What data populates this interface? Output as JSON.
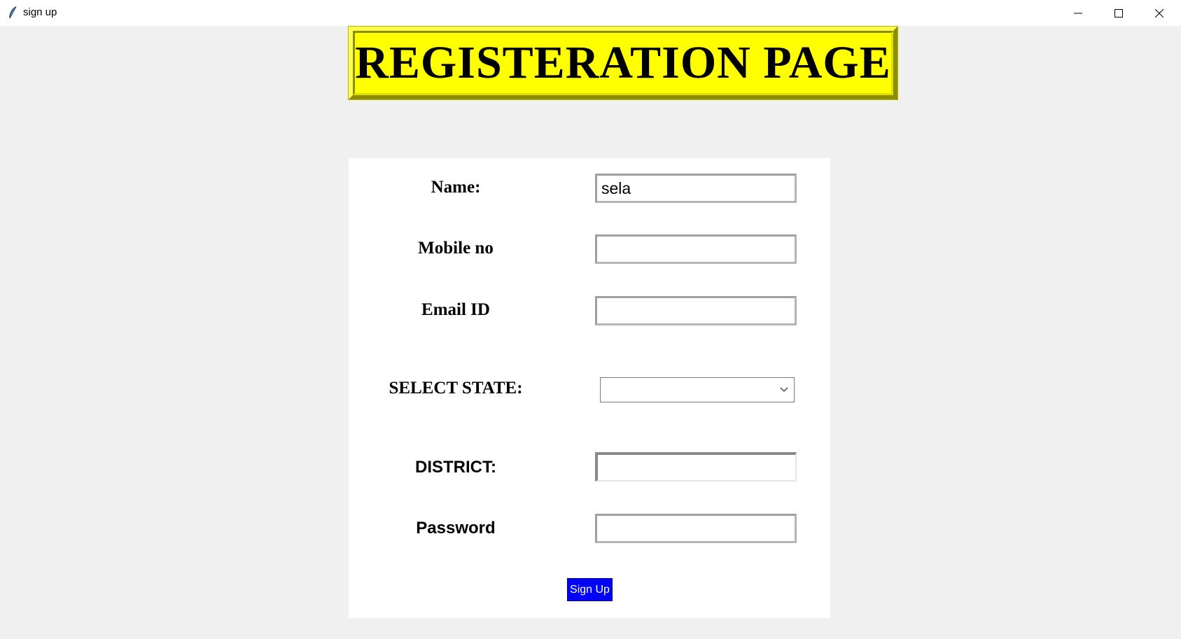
{
  "window": {
    "title": "sign up",
    "icon": "feather-icon"
  },
  "header": {
    "title": "REGISTERATION PAGE",
    "background_color": "#ffff00"
  },
  "form": {
    "fields": [
      {
        "label": "Name:",
        "value": "sela"
      },
      {
        "label": "Mobile no",
        "value": ""
      },
      {
        "label": "Email ID",
        "value": ""
      },
      {
        "label": "SELECT STATE:",
        "value": ""
      },
      {
        "label": "DISTRICT:",
        "value": ""
      },
      {
        "label": "Password",
        "value": ""
      }
    ],
    "submit_label": "Sign Up",
    "submit_color": "#0000ff"
  },
  "colors": {
    "window_background": "#f0f0f0",
    "panel_background": "#ffffff"
  }
}
